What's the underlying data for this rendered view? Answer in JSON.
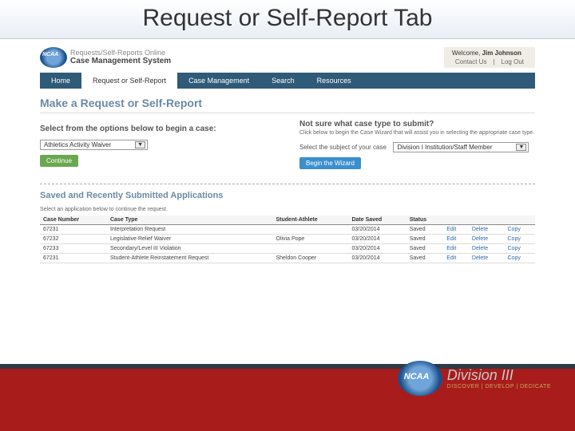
{
  "slide": {
    "title": "Request or Self-Report Tab"
  },
  "header": {
    "brand_line1": "Requests/Self-Reports Online",
    "brand_line2": "Case Management System",
    "welcome_prefix": "Welcome, ",
    "user_name": "Jim Johnson",
    "contact": "Contact Us",
    "logout": "Log Out"
  },
  "nav": {
    "items": [
      "Home",
      "Request or Self-Report",
      "Case Management",
      "Search",
      "Resources"
    ],
    "active_index": 1
  },
  "page": {
    "title": "Make a Request or Self-Report",
    "left_heading": "Select from the options below to begin a case:",
    "waiver_option": "Athletics Activity Waiver",
    "continue": "Continue",
    "right_heading": "Not sure what case type to submit?",
    "right_text": "Click below to begin the Case Wizard that will assist you in selecting the appropriate case type.",
    "subject_label": "Select the subject of your case",
    "subject_option": "Division I Institution/Staff Member",
    "begin_wizard": "Begin the Wizard",
    "saved_heading": "Saved and Recently Submitted Applications",
    "saved_sub": "Select an application below to continue the request."
  },
  "table": {
    "cols": [
      "Case Number",
      "Case Type",
      "Student-Athlete",
      "Date Saved",
      "Status",
      "",
      "",
      ""
    ],
    "rows": [
      {
        "num": "67231",
        "type": "Interpretation Request",
        "sa": "",
        "date": "03/20/2014",
        "status": "Saved",
        "a1": "Edit",
        "a2": "Delete",
        "a3": "Copy"
      },
      {
        "num": "67232",
        "type": "Legislative Relief Waiver",
        "sa": "Olivia Pope",
        "date": "03/20/2014",
        "status": "Saved",
        "a1": "Edit",
        "a2": "Delete",
        "a3": "Copy"
      },
      {
        "num": "67233",
        "type": "Secondary/Level III Violation",
        "sa": "",
        "date": "03/20/2014",
        "status": "Saved",
        "a1": "Edit",
        "a2": "Delete",
        "a3": "Copy"
      },
      {
        "num": "67231",
        "type": "Student-Athlete Reinstatement Request",
        "sa": "Sheldon Cooper",
        "date": "03/20/2014",
        "status": "Saved",
        "a1": "Edit",
        "a2": "Delete",
        "a3": "Copy"
      }
    ]
  },
  "footer": {
    "division": "Division III",
    "tagline": "DISCOVER | DEVELOP | DEDICATE"
  }
}
